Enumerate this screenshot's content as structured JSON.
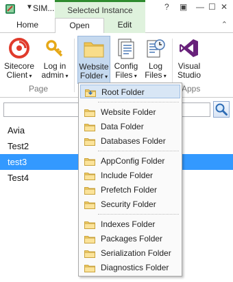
{
  "window": {
    "title": "SIM...",
    "context_tab_title": "Selected Instance",
    "colors": {
      "context": "#dff2dd",
      "context_border": "#2e8b2e",
      "selection": "#3399ff",
      "highlight": "#d8e6f5"
    }
  },
  "tabs": {
    "home": "Home",
    "open": "Open",
    "edit": "Edit"
  },
  "ribbon": {
    "sitecore_client": {
      "line1": "Sitecore",
      "line2": "Client",
      "icon": "sitecore-icon"
    },
    "log_in_admin": {
      "line1": "Log in",
      "line2": "admin",
      "icon": "key-icon"
    },
    "website_folder": {
      "line1": "Website",
      "line2": "Folder",
      "icon": "folder-icon"
    },
    "config_files": {
      "line1": "Config",
      "line2": "Files",
      "icon": "config-files-icon"
    },
    "log_files": {
      "line1": "Log",
      "line2": "Files",
      "icon": "log-files-icon"
    },
    "visual_studio": {
      "line1": "Visual",
      "line2": "Studio",
      "icon": "visual-studio-icon"
    },
    "group_page": "Page",
    "group_apps": "Apps"
  },
  "search": {
    "value": "",
    "placeholder": ""
  },
  "instances": [
    "Avia",
    "Test2",
    "test3",
    "Test4"
  ],
  "selected_instance": "test3",
  "folder_menu": {
    "root": "Root Folder",
    "website": "Website Folder",
    "data": "Data Folder",
    "databases": "Databases Folder",
    "appconfig": "AppConfig Folder",
    "include": "Include Folder",
    "prefetch": "Prefetch Folder",
    "security": "Security Folder",
    "indexes": "Indexes Folder",
    "packages": "Packages Folder",
    "serialization": "Serialization Folder",
    "diagnostics": "Diagnostics Folder"
  }
}
